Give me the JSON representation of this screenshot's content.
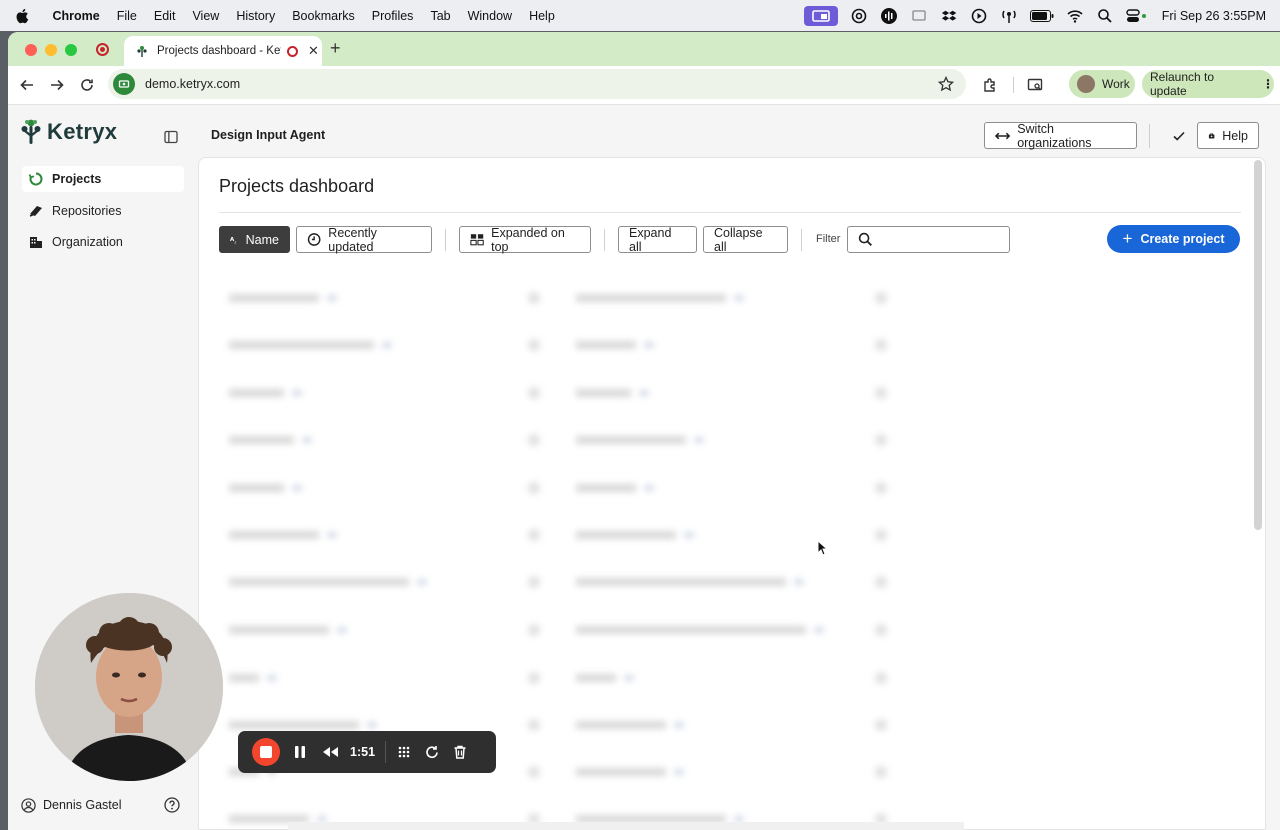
{
  "menubar": {
    "app_name": "Chrome",
    "items": [
      "File",
      "Edit",
      "View",
      "History",
      "Bookmarks",
      "Profiles",
      "Tab",
      "Window",
      "Help"
    ],
    "clock": "Fri Sep 26  3:55PM"
  },
  "browser": {
    "tab_title": "Projects dashboard - Ketryx",
    "url": "demo.ketryx.com",
    "profile_label": "Work",
    "relaunch_label": "Relaunch to update"
  },
  "app": {
    "logo_text": "Ketryx",
    "nav": [
      {
        "label": "Projects",
        "active": true
      },
      {
        "label": "Repositories",
        "active": false
      },
      {
        "label": "Organization",
        "active": false
      }
    ],
    "user_name": "Dennis Gastel",
    "topbar": {
      "title": "Design Input Agent",
      "switch_label": "Switch organizations",
      "help_label": "Help"
    },
    "dashboard": {
      "title": "Projects dashboard",
      "sort_name": "Name",
      "sort_recent": "Recently updated",
      "expanded_on_top": "Expanded on top",
      "expand_all": "Expand all",
      "collapse_all": "Collapse all",
      "filter_label": "Filter",
      "create_label": "Create project"
    }
  },
  "recorder": {
    "elapsed": "1:51"
  },
  "colors": {
    "tab_strip": "#d4ebc7",
    "accent_blue": "#1866d8",
    "record_red": "#f2462e",
    "brand_green": "#2e8a3a"
  }
}
